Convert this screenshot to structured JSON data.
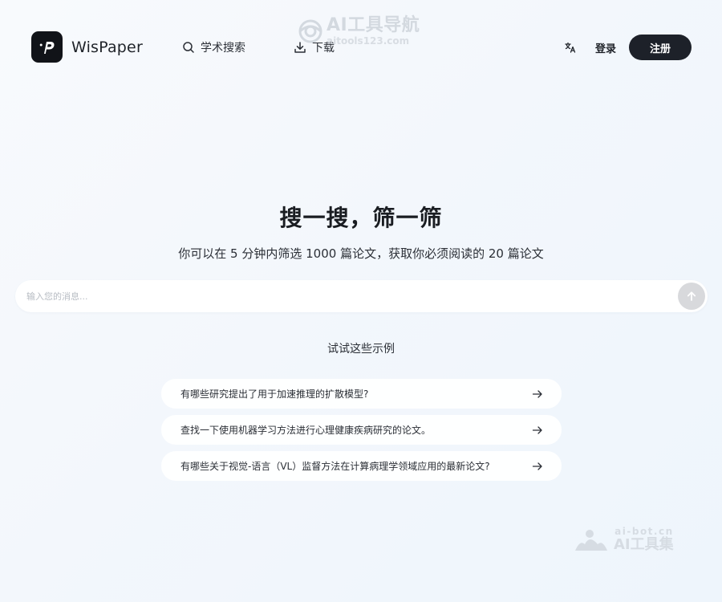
{
  "header": {
    "brand": "WisPaper",
    "nav": [
      {
        "label": "学术搜索",
        "icon": "search-icon"
      },
      {
        "label": "下载",
        "icon": "download-icon"
      }
    ],
    "translate_icon": "translate-icon",
    "login_label": "登录",
    "signup_label": "注册"
  },
  "watermarks": {
    "top_title": "AI工具导航",
    "top_sub": "aitools123.com",
    "bottom_sub": "ai-bot.cn",
    "bottom_title": "AI工具集"
  },
  "hero": {
    "title": "搜一搜，筛一筛",
    "subtitle": "你可以在 5 分钟内筛选 1000 篇论文，获取你必须阅读的 20 篇论文"
  },
  "search": {
    "placeholder": "输入您的消息...",
    "value": "",
    "send_icon": "arrow-up-icon"
  },
  "examples": {
    "heading": "试试这些示例",
    "items": [
      {
        "text": "有哪些研究提出了用于加速推理的扩散模型?",
        "icon": "arrow-right-icon"
      },
      {
        "text": "查找一下使用机器学习方法进行心理健康疾病研究的论文。",
        "icon": "arrow-right-icon"
      },
      {
        "text": "有哪些关于视觉-语言（VL）监督方法在计算病理学领域应用的最新论文?",
        "icon": "arrow-right-icon"
      }
    ]
  },
  "colors": {
    "accent_dark": "#1d2129",
    "send_button": "#d8d9dc",
    "background": "#f3f7fc"
  }
}
